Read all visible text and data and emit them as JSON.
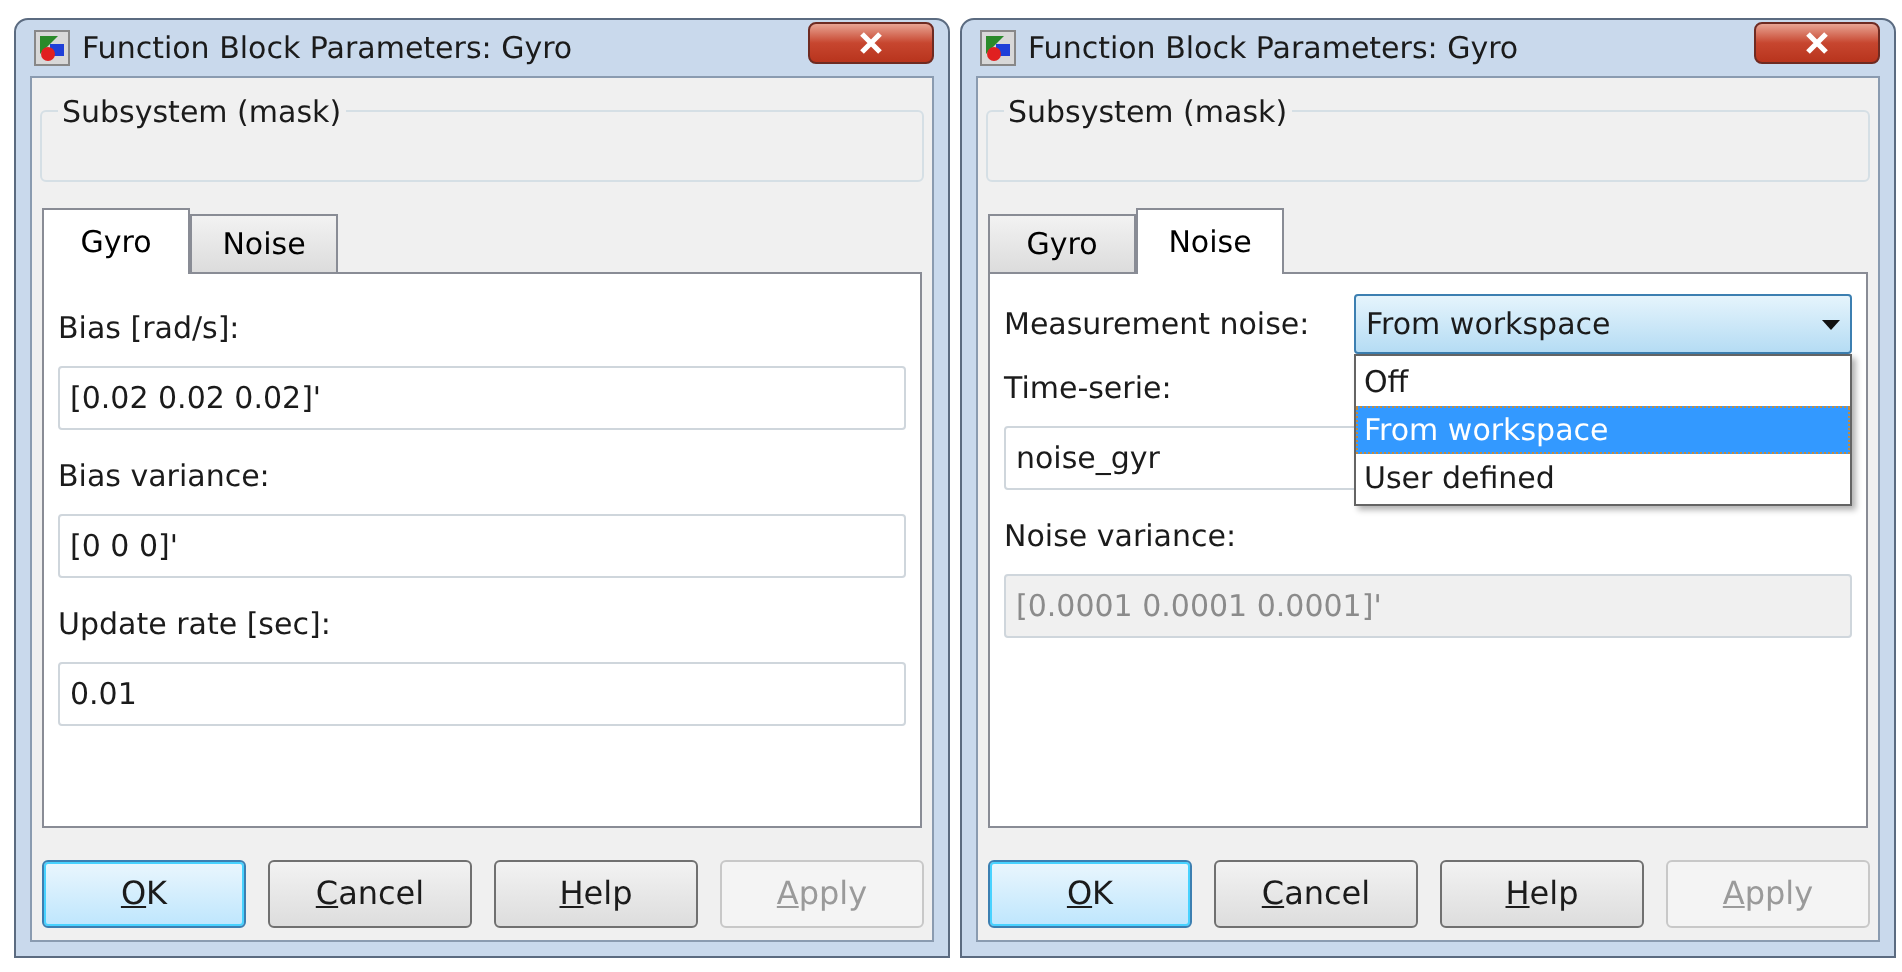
{
  "dialogs": [
    {
      "title": "Function Block Parameters: Gyro",
      "group_title": "Subsystem (mask)",
      "tabs": [
        {
          "label": "Gyro",
          "selected": true
        },
        {
          "label": "Noise",
          "selected": false
        }
      ],
      "params": [
        {
          "kind": "edit",
          "label": "Bias [rad/s]:",
          "value": "[0.02 0.02 0.02]'",
          "disabled": false
        },
        {
          "kind": "edit",
          "label": "Bias variance:",
          "value": "[0 0 0]'",
          "disabled": false
        },
        {
          "kind": "edit",
          "label": "Update rate [sec]:",
          "value": "0.01",
          "disabled": false
        }
      ],
      "buttons": [
        {
          "access_key": "O",
          "rest": "K",
          "default": true,
          "disabled": false
        },
        {
          "access_key": "C",
          "rest": "ancel",
          "default": false,
          "disabled": false
        },
        {
          "access_key": "H",
          "rest": "elp",
          "default": false,
          "disabled": false
        },
        {
          "access_key": "A",
          "rest": "pply",
          "default": false,
          "disabled": true
        }
      ]
    },
    {
      "title": "Function Block Parameters: Gyro",
      "group_title": "Subsystem (mask)",
      "tabs": [
        {
          "label": "Gyro",
          "selected": false
        },
        {
          "label": "Noise",
          "selected": true
        }
      ],
      "params": [
        {
          "kind": "popup",
          "label": "Measurement noise:",
          "value": "From workspace",
          "expanded": true,
          "options": [
            {
              "label": "Off",
              "selected": false
            },
            {
              "label": "From workspace",
              "selected": true
            },
            {
              "label": "User defined",
              "selected": false
            }
          ]
        },
        {
          "kind": "edit",
          "label": "Time-serie:",
          "value": "noise_gyr",
          "disabled": false
        },
        {
          "kind": "edit",
          "label": "Noise variance:",
          "value": "[0.0001 0.0001 0.0001]'",
          "disabled": true
        }
      ],
      "buttons": [
        {
          "access_key": "O",
          "rest": "K",
          "default": true,
          "disabled": false
        },
        {
          "access_key": "C",
          "rest": "ancel",
          "default": false,
          "disabled": false
        },
        {
          "access_key": "H",
          "rest": "elp",
          "default": false,
          "disabled": false
        },
        {
          "access_key": "A",
          "rest": "pply",
          "default": false,
          "disabled": true
        }
      ]
    }
  ]
}
